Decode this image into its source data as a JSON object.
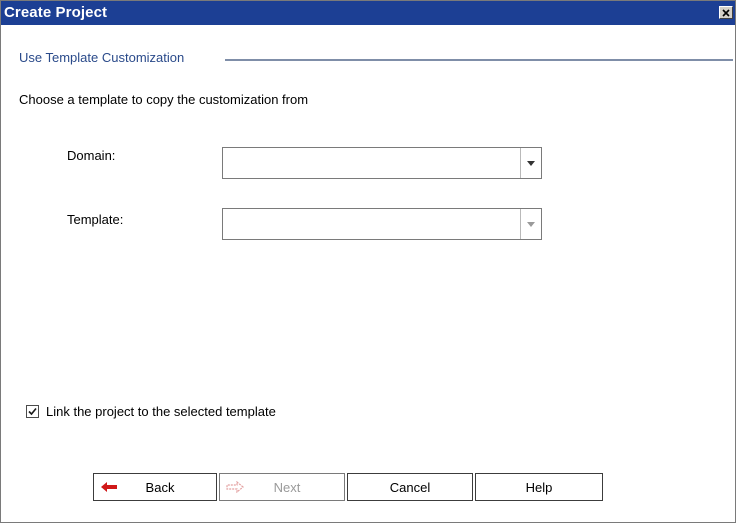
{
  "window": {
    "title": "Create Project",
    "close_icon": "close-icon"
  },
  "section": {
    "heading": "Use Template Customization",
    "instruction": "Choose a template to copy the customization from"
  },
  "form": {
    "domain_label": "Domain:",
    "domain_value": "",
    "template_label": "Template:",
    "template_value": ""
  },
  "link_option": {
    "label": "Link the project to the selected template",
    "checked": true
  },
  "buttons": {
    "back": "Back",
    "next": "Next",
    "cancel": "Cancel",
    "help": "Help"
  },
  "colors": {
    "titlebar": "#1c3f94",
    "section_heading": "#2a4a8a",
    "back_arrow": "#d01818",
    "next_arrow_disabled": "#e3a0a0"
  }
}
